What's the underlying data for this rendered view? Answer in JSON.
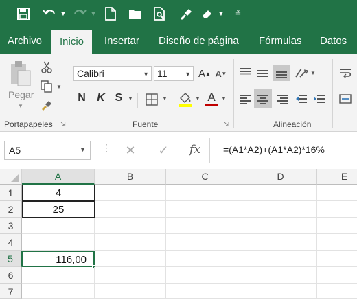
{
  "qat": {
    "icons": [
      "save-icon",
      "undo-icon",
      "redo-icon",
      "new-document-icon",
      "open-folder-icon",
      "print-preview-icon",
      "format-painter-icon",
      "eraser-icon",
      "customize-qat-icon"
    ]
  },
  "tabs": [
    "Archivo",
    "Inicio",
    "Insertar",
    "Diseño de página",
    "Fórmulas",
    "Datos"
  ],
  "ribbon": {
    "portapapeles": {
      "paste_label": "Pegar",
      "group_label": "Portapapeles"
    },
    "fuente": {
      "font_name": "Calibri",
      "font_size": "11",
      "bold": "N",
      "italic": "K",
      "underline": "S",
      "font_color_letter": "A",
      "grow_letter": "A",
      "shrink_letter": "A",
      "group_label": "Fuente",
      "fill_color": "#ffff00",
      "font_color": "#c00000"
    },
    "alineacion": {
      "group_label": "Alineación"
    }
  },
  "formula_bar": {
    "name_box": "A5",
    "fx": "fx",
    "formula": "=(A1*A2)+(A1*A2)*16%"
  },
  "sheet": {
    "columns": [
      "A",
      "B",
      "C",
      "D",
      "E"
    ],
    "rows": [
      "1",
      "2",
      "3",
      "4",
      "5",
      "6",
      "7"
    ],
    "cells": {
      "A1": "4",
      "A2": "25",
      "A5": "116,00"
    },
    "active_cell": "A5",
    "accent": "#217346"
  }
}
